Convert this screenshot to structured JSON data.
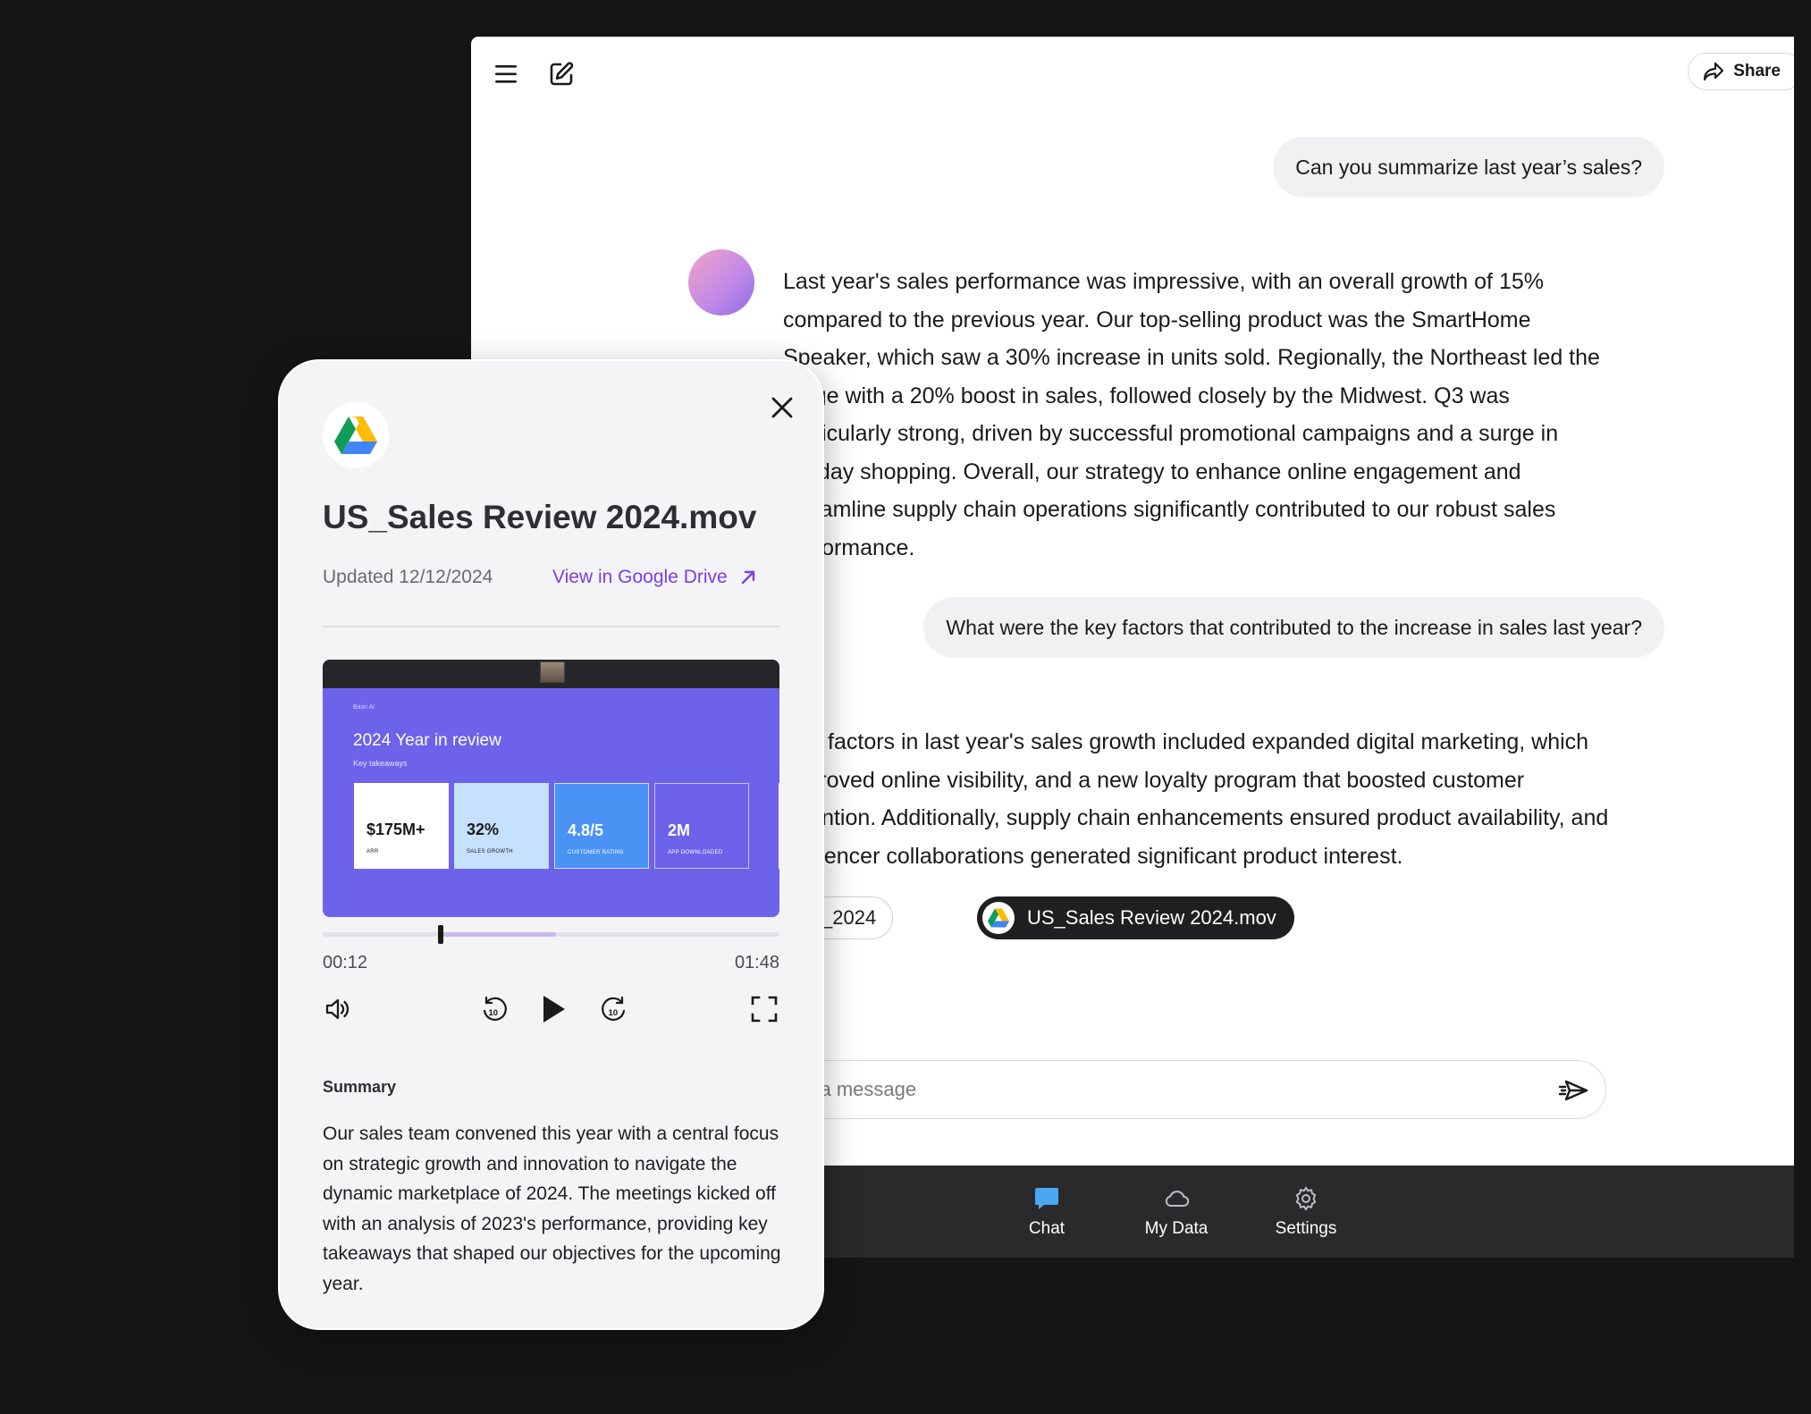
{
  "header": {
    "menu_icon": "hamburger-menu-icon",
    "new_chat_icon": "edit-compose-icon",
    "share_label": "Share"
  },
  "conversation": {
    "user_message_1": "Can you summarize last year’s sales?",
    "bot_message_1_lines": [
      "Last year's sales performance was impressive, with an overall growth of 15%",
      "compared to the previous year. Our top-selling product was the SmartHome",
      "Speaker, which saw a 30% increase in units sold. Regionally, the Northeast led the",
      "surge with a 20% boost in sales, followed closely by the Midwest. Q3 was",
      "particularly strong, driven by successful promotional campaigns and a surge in",
      "holiday shopping. Overall, our strategy to enhance online engagement and",
      "streamline supply chain operations significantly contributed to our robust sales",
      "performance."
    ],
    "user_message_2": "What were the key factors that contributed to the increase in sales last year?",
    "bot_message_2_lines": [
      "Key factors in last year's sales growth included expanded digital marketing, which",
      "improved online visibility, and a new loyalty program that boosted customer",
      "retention. Additionally, supply chain enhancements ensured product availability, and",
      "influencer collaborations generated significant product interest."
    ],
    "sources": [
      {
        "label": "Sales_2024"
      },
      {
        "label": "US_Sales Review 2024.mov"
      }
    ]
  },
  "composer": {
    "placeholder": "Send a message",
    "send_icon": "send-icon"
  },
  "bottom_nav": {
    "items": [
      {
        "label": "Chat",
        "icon": "chat-bubble-icon",
        "active": true
      },
      {
        "label": "My Data",
        "icon": "cloud-icon",
        "active": false
      },
      {
        "label": "Settings",
        "icon": "gear-icon",
        "active": false
      }
    ],
    "active_color": "#4aa8f0"
  },
  "preview_panel": {
    "title": "US_Sales Review 2024.mov",
    "updated": "Updated 12/12/2024",
    "drive_link": "View in Google Drive",
    "link_color": "#7b3fe4",
    "video": {
      "slide_brand": "Basri AI",
      "slide_title": "2024 Year in review",
      "slide_subtitle": "Key takeaways",
      "stats": [
        {
          "value": "$175M+",
          "label": "ARR"
        },
        {
          "value": "32%",
          "label": "SALES GROWTH"
        },
        {
          "value": "4.8/5",
          "label": "CUSTOMER RATING"
        },
        {
          "value": "2M",
          "label": "APP DOWNLOADED"
        }
      ],
      "slide_color": "#6d62ea"
    },
    "player": {
      "current_time": "00:12",
      "duration": "01:48",
      "progress_fraction": 0.259,
      "buffered_fraction": 0.51,
      "controls": [
        "volume-icon",
        "rewind-10-icon",
        "play-icon",
        "forward-10-icon",
        "fullscreen-icon"
      ]
    },
    "summary_heading": "Summary",
    "summary_text": "Our sales team convened this year with a central focus on strategic growth and innovation to navigate the dynamic marketplace of 2024. The meetings kicked off with an analysis of 2023's performance, providing key takeaways that shaped our objectives for the upcoming year."
  }
}
